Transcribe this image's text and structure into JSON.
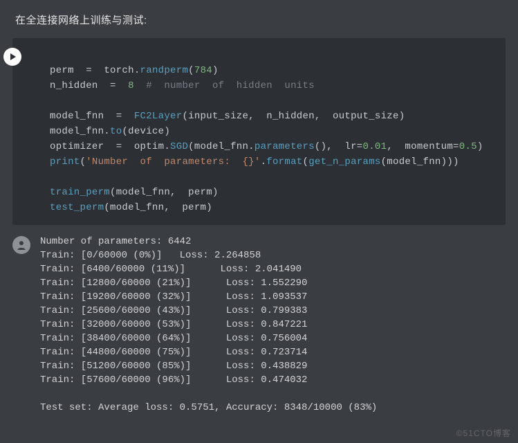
{
  "heading": "在全连接网络上训练与测试:",
  "code": {
    "l1": {
      "a": "perm",
      "b": "=",
      "c": "torch.",
      "d": "randperm",
      "e": "(",
      "f": "784",
      "g": ")"
    },
    "l2": {
      "a": "n_hidden",
      "b": "=",
      "c": "8",
      "d": "#  number  of  hidden  units"
    },
    "l3": {
      "a": "model_fnn",
      "b": "=",
      "c": "FC2Layer",
      "d": "(input_size,  n_hidden,  output_size)"
    },
    "l4": {
      "a": "model_fnn.",
      "b": "to",
      "c": "(device)"
    },
    "l5": {
      "a": "optimizer",
      "b": "=",
      "c": "optim.",
      "d": "SGD",
      "e": "(model_fnn.",
      "f": "parameters",
      "g": "(),  lr=",
      "h": "0.01",
      "i": ",  momentum=",
      "j": "0.5",
      "k": ")"
    },
    "l6": {
      "a": "print",
      "b": "(",
      "c": "'Number  of  parameters:  {}'",
      "d": ".",
      "e": "format",
      "f": "(",
      "g": "get_n_params",
      "h": "(model_fnn)))"
    },
    "l7": {
      "a": "train_perm",
      "b": "(model_fnn,  perm)"
    },
    "l8": {
      "a": "test_perm",
      "b": "(model_fnn,  perm)"
    }
  },
  "output": {
    "params": "Number of parameters: 6442",
    "train": [
      "Train: [0/60000 (0%)]   Loss: 2.264858",
      "Train: [6400/60000 (11%)]      Loss: 2.041490",
      "Train: [12800/60000 (21%)]      Loss: 1.552290",
      "Train: [19200/60000 (32%)]      Loss: 1.093537",
      "Train: [25600/60000 (43%)]      Loss: 0.799383",
      "Train: [32000/60000 (53%)]      Loss: 0.847221",
      "Train: [38400/60000 (64%)]      Loss: 0.756004",
      "Train: [44800/60000 (75%)]      Loss: 0.723714",
      "Train: [51200/60000 (85%)]      Loss: 0.438829",
      "Train: [57600/60000 (96%)]      Loss: 0.474032"
    ],
    "test": "Test set: Average loss: 0.5751, Accuracy: 8348/10000 (83%)"
  },
  "watermark": "©51CTO博客"
}
